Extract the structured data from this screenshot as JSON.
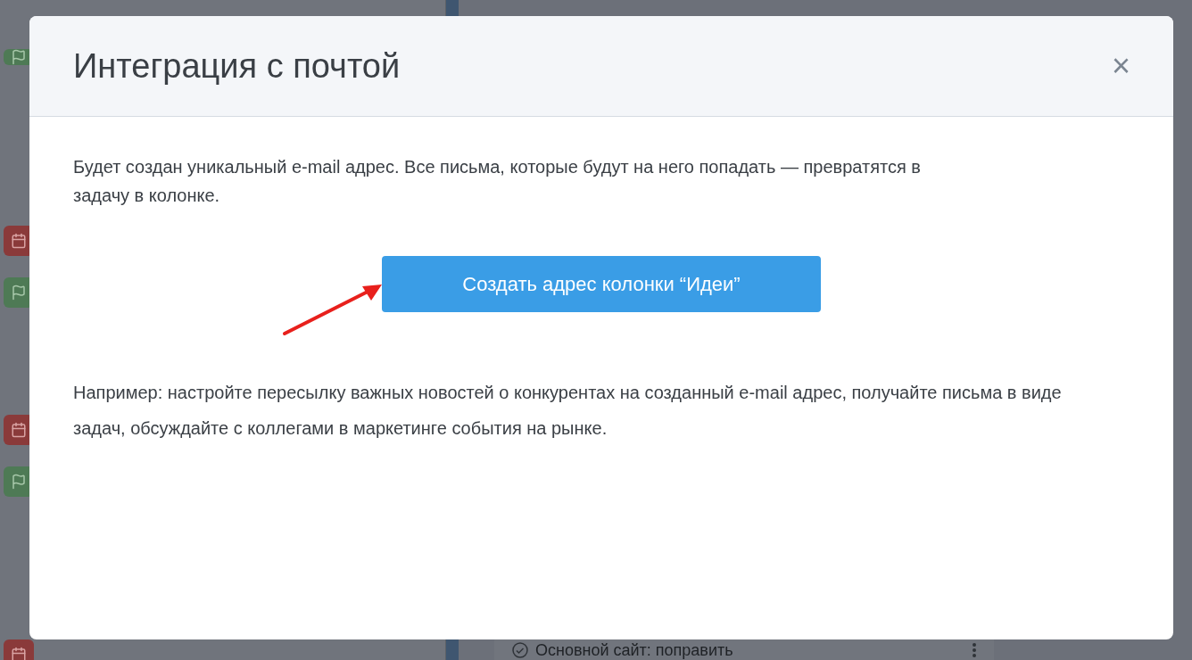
{
  "background": {
    "task_title": "Основной сайт: поправить"
  },
  "modal": {
    "title": "Интеграция с почтой",
    "close": "×",
    "description": "Будет создан уникальный e-mail адрес. Все письма, которые будут на него попадать — превратятся в задачу в колонке.",
    "button": "Создать адрес колонки “Идеи”",
    "example": "Например: настройте пересылку важных новостей о конкурентах на созданный e-mail адрес, получайте письма в виде задач, обсуждайте с коллегами в маркетинге события на рынке."
  }
}
